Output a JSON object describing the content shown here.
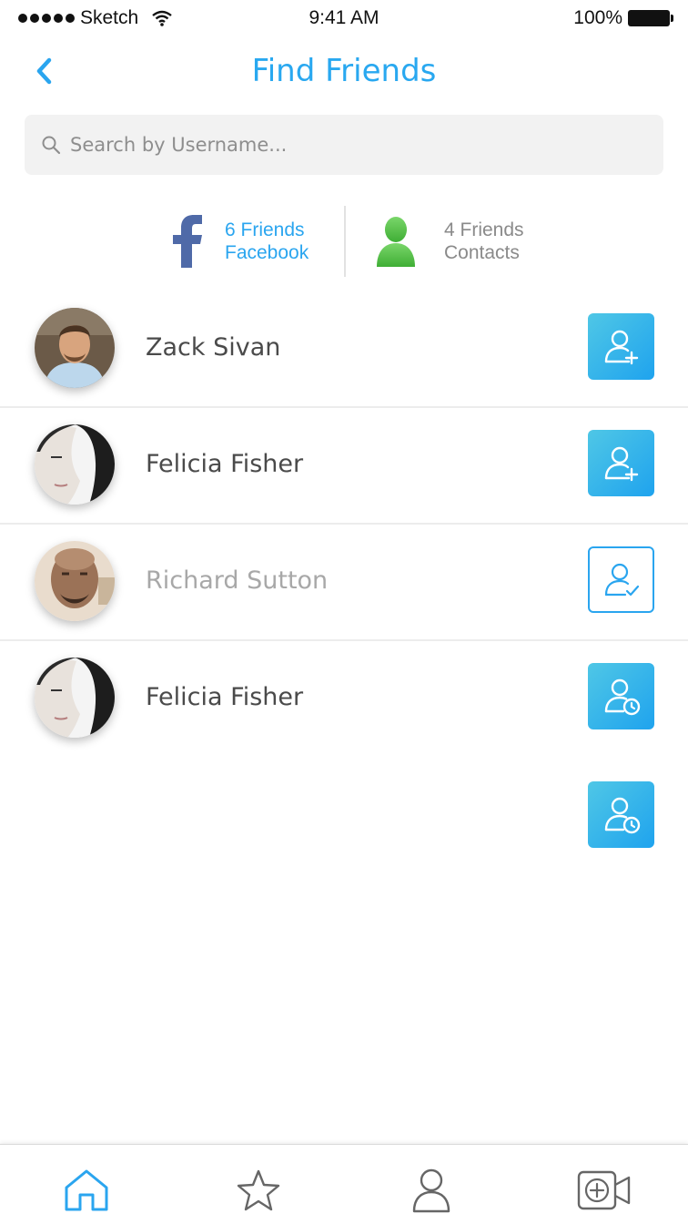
{
  "status_bar": {
    "carrier": "Sketch",
    "time": "9:41 AM",
    "battery": "100%"
  },
  "header": {
    "title": "Find Friends",
    "back_icon": "chevron-left-icon"
  },
  "search": {
    "placeholder": "Search by Username...",
    "value": ""
  },
  "sources": [
    {
      "count": "6 Friends",
      "name": "Facebook",
      "icon": "facebook-icon"
    },
    {
      "count": "4 Friends",
      "name": "Contacts",
      "icon": "contact-person-icon"
    }
  ],
  "friends": [
    {
      "name": "Zack Sivan",
      "action": "add-friend-icon"
    },
    {
      "name": "Felicia Fisher",
      "action": "add-friend-icon"
    },
    {
      "name": "Richard Sutton",
      "action": "friend-added-check-icon"
    },
    {
      "name": "Felicia Fisher",
      "action": "friend-pending-clock-icon"
    }
  ],
  "extra_action": "friend-pending-clock-icon",
  "tabs": [
    "home-icon",
    "star-icon",
    "profile-icon",
    "add-video-icon"
  ],
  "colors": {
    "accent": "#2aa5ef",
    "facebook": "#4f6aa8",
    "contacts": "#5cc24a",
    "muted_text": "#a8a8a8"
  }
}
